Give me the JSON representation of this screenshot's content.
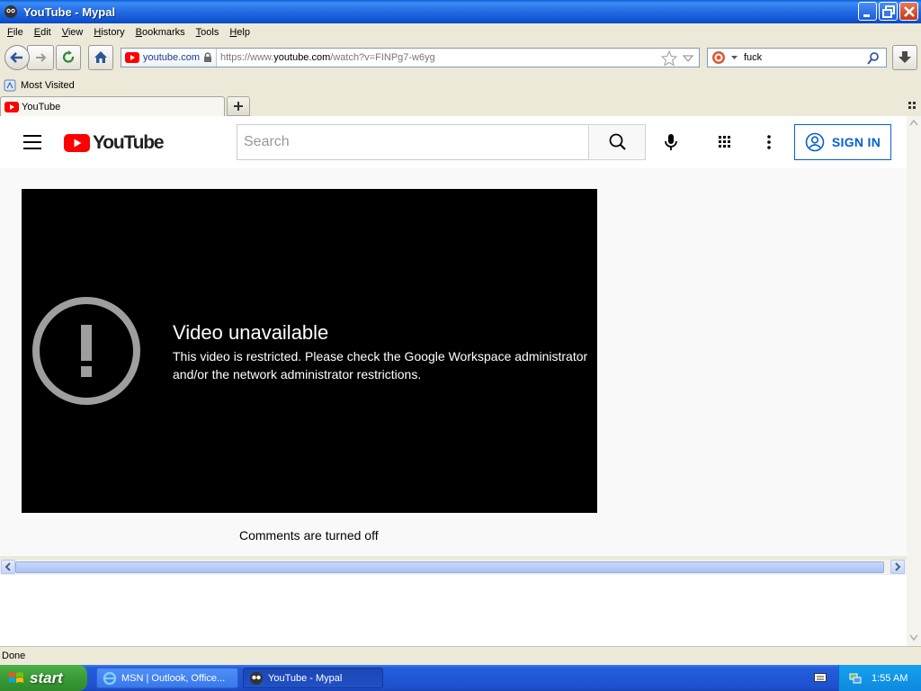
{
  "window": {
    "title": "YouTube - Mypal"
  },
  "menu": [
    "File",
    "Edit",
    "View",
    "History",
    "Bookmarks",
    "Tools",
    "Help"
  ],
  "navbar": {
    "site_identity": "youtube.com",
    "url_prefix": "https://www.",
    "url_domain": "youtube.com",
    "url_path": "/watch?v=FINPg7-w6yg",
    "search_value": "fuck"
  },
  "bookmarks": {
    "most_visited": "Most Visited"
  },
  "tabs": [
    {
      "label": "YouTube"
    }
  ],
  "youtube": {
    "brand": "YouTube",
    "search_placeholder": "Search",
    "sign_in": "SIGN IN",
    "player": {
      "title": "Video unavailable",
      "message": "This video is restricted. Please check the Google Workspace administrator and/or the network administrator restrictions."
    },
    "comments_status": "Comments are turned off"
  },
  "status": {
    "text": "Done"
  },
  "taskbar": {
    "start": "start",
    "items": [
      {
        "label": "MSN | Outlook, Office..."
      },
      {
        "label": "YouTube - Mypal"
      }
    ],
    "clock": "1:55 AM"
  },
  "colors": {
    "yt_red": "#FF0000",
    "yt_blue": "#065FD4",
    "xp_blue": "#245EDC",
    "start_green": "#3A9A36"
  }
}
